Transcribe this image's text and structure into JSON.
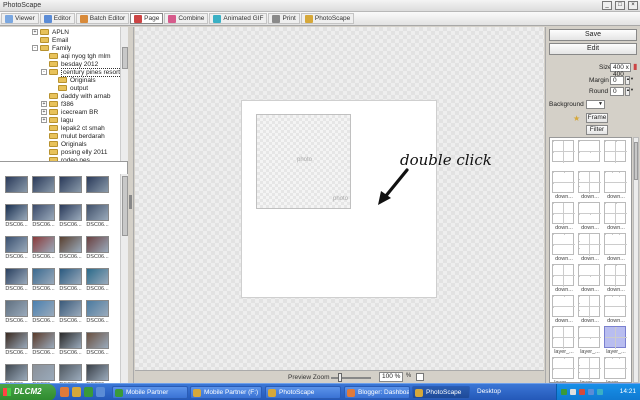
{
  "window": {
    "title": "PhotoScape"
  },
  "tabs": [
    {
      "label": "Viewer",
      "color": "#7aa7e0",
      "active": false
    },
    {
      "label": "Editor",
      "color": "#5b8cd6",
      "active": false
    },
    {
      "label": "Batch Editor",
      "color": "#d88a3a",
      "active": false
    },
    {
      "label": "Page",
      "color": "#c44",
      "active": true
    },
    {
      "label": "Combine",
      "color": "#d65b8c",
      "active": false
    },
    {
      "label": "Animated GIF",
      "color": "#3ab0c4",
      "active": false
    },
    {
      "label": "Print",
      "color": "#8a8a8a",
      "active": false
    },
    {
      "label": "PhotoScape",
      "color": "#d6a83a",
      "active": false
    }
  ],
  "tree": [
    {
      "label": "APLN",
      "level": 2,
      "exp": "+"
    },
    {
      "label": "Email",
      "level": 2,
      "exp": ""
    },
    {
      "label": "Family",
      "level": 2,
      "exp": "-"
    },
    {
      "label": "aqi nyog tgh mlm",
      "level": 3,
      "exp": ""
    },
    {
      "label": "besday 2012",
      "level": 3,
      "exp": ""
    },
    {
      "label": "century pines resort",
      "level": 3,
      "exp": "-",
      "selected": true
    },
    {
      "label": "Originals",
      "level": 4,
      "exp": ""
    },
    {
      "label": "output",
      "level": 4,
      "exp": ""
    },
    {
      "label": "daddy with arnab",
      "level": 3,
      "exp": ""
    },
    {
      "label": "f386",
      "level": 3,
      "exp": "+"
    },
    {
      "label": "icecream BR",
      "level": 3,
      "exp": "+"
    },
    {
      "label": "lagu",
      "level": 3,
      "exp": "+"
    },
    {
      "label": "lepak2 ct smah",
      "level": 3,
      "exp": ""
    },
    {
      "label": "mulut berdarah",
      "level": 3,
      "exp": ""
    },
    {
      "label": "Originals",
      "level": 3,
      "exp": ""
    },
    {
      "label": "posing elly 2011",
      "level": 3,
      "exp": ""
    },
    {
      "label": "rodeo pes...",
      "level": 3,
      "exp": ""
    }
  ],
  "thumbnails": [
    {
      "caption": "DSC06...",
      "color": "#1a3050"
    },
    {
      "caption": "DSC06...",
      "color": "#3a4a6a"
    },
    {
      "caption": "DSC06...",
      "color": "#2a3a5a"
    },
    {
      "caption": "DSC06...",
      "color": "#40506a"
    },
    {
      "caption": "DSC06...",
      "color": "#3a5070"
    },
    {
      "caption": "DSC06...",
      "color": "#8a3a3a"
    },
    {
      "caption": "DSC06...",
      "color": "#5a4030"
    },
    {
      "caption": "DSC06...",
      "color": "#6a4040"
    },
    {
      "caption": "DSC06...",
      "color": "#2a4060"
    },
    {
      "caption": "DSC06...",
      "color": "#3a6a90"
    },
    {
      "caption": "DSC06...",
      "color": "#2a5a80"
    },
    {
      "caption": "DSC06...",
      "color": "#2a6a8a"
    },
    {
      "caption": "DSC06...",
      "color": "#607080"
    },
    {
      "caption": "DSC06...",
      "color": "#4a80b0"
    },
    {
      "caption": "DSC06...",
      "color": "#3a5a7a"
    },
    {
      "caption": "DSC06...",
      "color": "#4a7aa0"
    },
    {
      "caption": "DSC06...",
      "color": "#3a2a20"
    },
    {
      "caption": "DSC06...",
      "color": "#5a3a2a"
    },
    {
      "caption": "DSC06...",
      "color": "#2a2a2a"
    },
    {
      "caption": "DSC06...",
      "color": "#6a5040"
    },
    {
      "caption": "DSC06...",
      "color": "#404850"
    },
    {
      "caption": "DSC06...",
      "color": "#8a9098"
    },
    {
      "caption": "DSC06...",
      "color": "#505860"
    },
    {
      "caption": "DSC06...",
      "color": "#3a4048"
    }
  ],
  "canvas": {
    "placeholder1": "photo",
    "placeholder2": "photo",
    "annotation": "double click"
  },
  "zoom": {
    "label": "Preview Zoom",
    "value": "100 %",
    "pct_symbol": "%"
  },
  "right_panel": {
    "save_label": "Save",
    "edit_label": "Edit",
    "size_label": "Size",
    "size_value": "400 x 400",
    "margin_label": "Margin",
    "margin_value": "0",
    "round_label": "Round",
    "round_value": "0",
    "background_label": "Background",
    "frame_label": "Frame",
    "filter_label": "Filter"
  },
  "layouts": [
    {
      "caption": ""
    },
    {
      "caption": ""
    },
    {
      "caption": ""
    },
    {
      "caption": "down..."
    },
    {
      "caption": "down..."
    },
    {
      "caption": "down..."
    },
    {
      "caption": "down..."
    },
    {
      "caption": "down..."
    },
    {
      "caption": "down..."
    },
    {
      "caption": "down..."
    },
    {
      "caption": "down..."
    },
    {
      "caption": "down..."
    },
    {
      "caption": "down..."
    },
    {
      "caption": "down..."
    },
    {
      "caption": "down..."
    },
    {
      "caption": "down..."
    },
    {
      "caption": "down..."
    },
    {
      "caption": "down..."
    },
    {
      "caption": "layer_..."
    },
    {
      "caption": "layer_..."
    },
    {
      "caption": "layer_..."
    },
    {
      "caption": "layer_..."
    },
    {
      "caption": "layer_..."
    },
    {
      "caption": "layer_..."
    }
  ],
  "taskbar": {
    "start_label": "DLCM2",
    "items": [
      {
        "label": "Mobile Partner",
        "color": "#3a9a3a",
        "active": false
      },
      {
        "label": "Mobile Partner (F:)",
        "color": "#d6a83a",
        "active": false
      },
      {
        "label": "PhotoScape",
        "color": "#d6a83a",
        "active": false
      },
      {
        "label": "Blogger: Dashboard...",
        "color": "#e07a3a",
        "active": false
      },
      {
        "label": "PhotoScape",
        "color": "#d6a83a",
        "active": true
      }
    ],
    "desktop_label": "Desktop",
    "clock": "14:21"
  }
}
